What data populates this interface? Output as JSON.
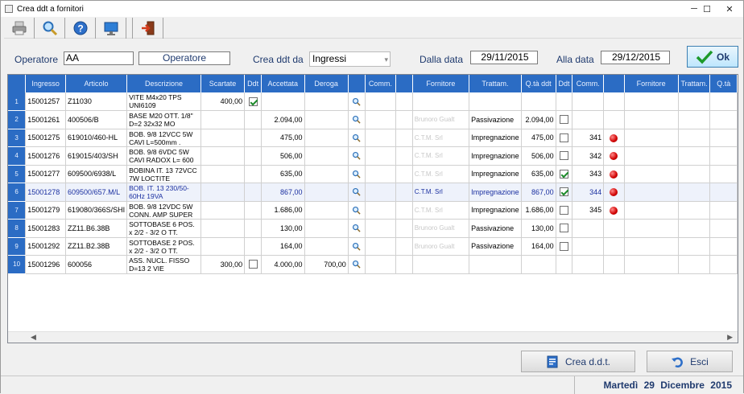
{
  "window": {
    "title": "Crea ddt a fornitori",
    "minimize": "─",
    "maximize": "☐",
    "close": "✕"
  },
  "toolbar": {
    "icons": [
      "printer-icon",
      "magnifier-icon",
      "help-icon",
      "monitor-icon",
      "exit-icon"
    ]
  },
  "form": {
    "operatore_label": "Operatore",
    "operatore_value": "AA",
    "operatore_button": "Operatore",
    "crea_label": "Crea ddt da",
    "crea_value": "Ingressi",
    "dalla_label": "Dalla data",
    "dalla_value": "29/11/2015",
    "alla_label": "Alla data",
    "alla_value": "29/12/2015",
    "ok_label": "Ok"
  },
  "grid": {
    "columns": [
      "Ingresso",
      "Articolo",
      "Descrizione",
      "Scartate",
      "Ddt",
      "Accettata",
      "Deroga",
      "",
      "Comm.",
      "",
      "Fornitore",
      "Trattam.",
      "Q.tà ddt",
      "Ddt",
      "Comm.",
      "",
      "Fornitore",
      "Trattam.",
      "Q.tà"
    ],
    "rows": [
      {
        "n": "1",
        "ingresso": "15001257",
        "articolo": "Z11030",
        "descrizione": "VITE M4x20 TPS UNI6109",
        "scartate": "400,00",
        "ddt1": "on",
        "accettata": "",
        "deroga": "",
        "comm": "",
        "fornitore": "",
        "trattam": "",
        "qta": "",
        "ddt2": "",
        "comm2": "",
        "dot": false
      },
      {
        "n": "2",
        "ingresso": "15001261",
        "articolo": "400506/B",
        "descrizione": "BASE M20 OTT. 1/8\" D=2 32x32 MO",
        "scartate": "",
        "ddt1": "",
        "accettata": "2.094,00",
        "deroga": "",
        "comm": "",
        "fornitore": "Brunoro Gualt",
        "trattam": "Passivazione",
        "qta": "2.094,00",
        "ddt2": "off",
        "comm2": "",
        "dot": false
      },
      {
        "n": "3",
        "ingresso": "15001275",
        "articolo": "619010/460-HL",
        "descrizione": "BOB. 9/8 12VCC 5W CAVI L=500mm .",
        "scartate": "",
        "ddt1": "",
        "accettata": "475,00",
        "deroga": "",
        "comm": "",
        "fornitore": "C.T.M. Srl",
        "trattam": "Impregnazione",
        "qta": "475,00",
        "ddt2": "off",
        "comm2": "341",
        "dot": true
      },
      {
        "n": "4",
        "ingresso": "15001276",
        "articolo": "619015/403/SH",
        "descrizione": "BOB. 9/8 6VDC 5W CAVI RADOX L= 600",
        "scartate": "",
        "ddt1": "",
        "accettata": "506,00",
        "deroga": "",
        "comm": "",
        "fornitore": "C.T.M. Srl",
        "trattam": "Impregnazione",
        "qta": "506,00",
        "ddt2": "off",
        "comm2": "342",
        "dot": true
      },
      {
        "n": "5",
        "ingresso": "15001277",
        "articolo": "609500/6938/L",
        "descrizione": "BOBINA IT. 13 72VCC 7W LOCTITE",
        "scartate": "",
        "ddt1": "",
        "accettata": "635,00",
        "deroga": "",
        "comm": "",
        "fornitore": "C.T.M. Srl",
        "trattam": "Impregnazione",
        "qta": "635,00",
        "ddt2": "on",
        "comm2": "343",
        "dot": true
      },
      {
        "n": "6",
        "ingresso": "15001278",
        "articolo": "609500/657.M/L",
        "descrizione": "BOB. IT. 13 230/50-60Hz 19VA",
        "scartate": "",
        "ddt1": "",
        "accettata": "867,00",
        "deroga": "",
        "comm": "",
        "fornitore": "C.T.M. Srl",
        "trattam": "Impregnazione",
        "qta": "867,00",
        "ddt2": "on",
        "comm2": "344",
        "dot": true
      },
      {
        "n": "7",
        "ingresso": "15001279",
        "articolo": "619080/366S/SHI",
        "descrizione": "BOB. 9/8 12VDC 5W CONN. AMP SUPER",
        "scartate": "",
        "ddt1": "",
        "accettata": "1.686,00",
        "deroga": "",
        "comm": "",
        "fornitore": "C.T.M. Srl",
        "trattam": "Impregnazione",
        "qta": "1.686,00",
        "ddt2": "off",
        "comm2": "345",
        "dot": true
      },
      {
        "n": "8",
        "ingresso": "15001283",
        "articolo": "ZZ11.B6.38B",
        "descrizione": "SOTTOBASE 6 POS. x 2/2 - 3/2 O TT.",
        "scartate": "",
        "ddt1": "",
        "accettata": "130,00",
        "deroga": "",
        "comm": "",
        "fornitore": "Brunoro Gualt",
        "trattam": "Passivazione",
        "qta": "130,00",
        "ddt2": "off",
        "comm2": "",
        "dot": false
      },
      {
        "n": "9",
        "ingresso": "15001292",
        "articolo": "ZZ11.B2.38B",
        "descrizione": "SOTTOBASE 2 POS. x 2/2 - 3/2 O TT.",
        "scartate": "",
        "ddt1": "",
        "accettata": "164,00",
        "deroga": "",
        "comm": "",
        "fornitore": "Brunoro Gualt",
        "trattam": "Passivazione",
        "qta": "164,00",
        "ddt2": "off",
        "comm2": "",
        "dot": false
      },
      {
        "n": "10",
        "ingresso": "15001296",
        "articolo": "600056",
        "descrizione": "ASS. NUCL. FISSO D=13 2 VIE",
        "scartate": "300,00",
        "ddt1": "off",
        "accettata": "4.000,00",
        "deroga": "700,00",
        "comm": "",
        "fornitore": "",
        "trattam": "",
        "qta": "",
        "ddt2": "",
        "comm2": "",
        "dot": false
      }
    ],
    "selected_row": 6
  },
  "buttons": {
    "crea": "Crea d.d.t.",
    "esci": "Esci"
  },
  "status": {
    "day": "Martedì",
    "date": "29 Dicembre",
    "year": "2015"
  }
}
